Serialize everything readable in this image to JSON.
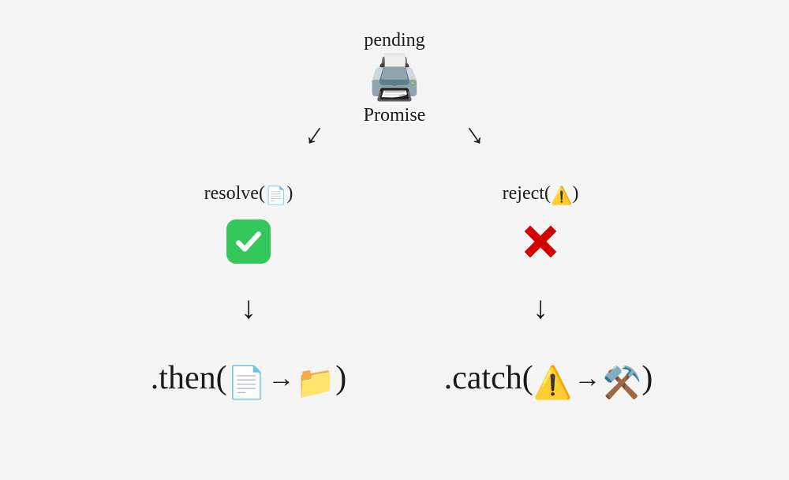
{
  "top": {
    "pending_label": "pending",
    "promise_label": "Promise",
    "printer_icon": "🖨️"
  },
  "left": {
    "resolve_label": "resolve(",
    "resolve_icon": "📄",
    "resolve_close": ")",
    "then_prefix": ".then(",
    "then_icon_from": "📄",
    "then_icon_to": "📁",
    "then_suffix": ")"
  },
  "right": {
    "reject_label": "reject(",
    "reject_icon": "⚠️",
    "reject_close": ")",
    "catch_prefix": ".catch(",
    "catch_icon_from": "⚠️",
    "catch_icon_to": "⚒️",
    "catch_suffix": ")"
  }
}
